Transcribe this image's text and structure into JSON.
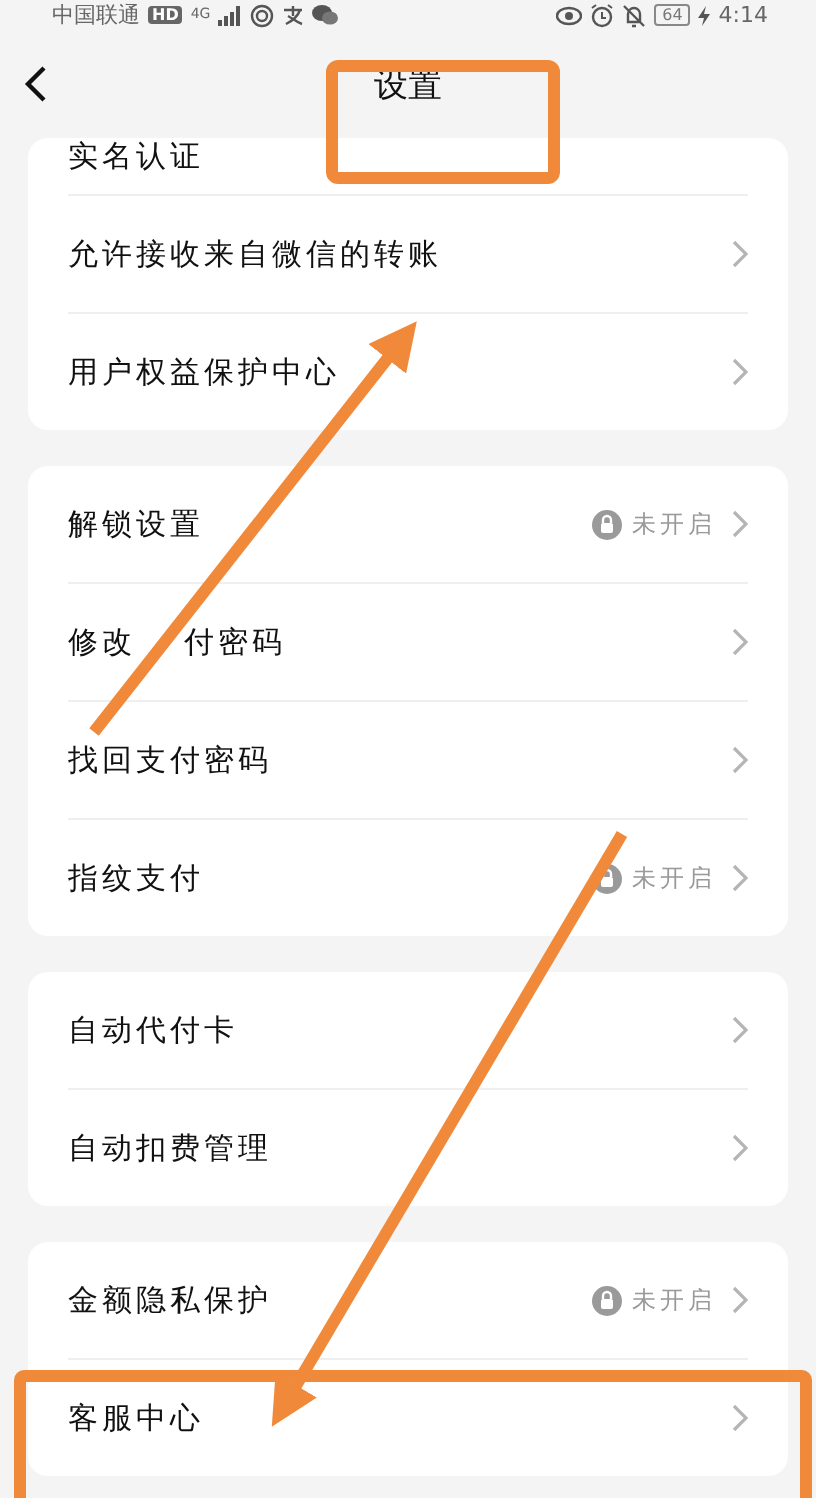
{
  "status_bar": {
    "carrier": "中国联通",
    "hd_badge": "HD",
    "network": "4G",
    "battery": "64",
    "time": "4:14"
  },
  "header": {
    "title": "设置"
  },
  "groups": [
    {
      "items": [
        {
          "label": "实名认证",
          "cut": true
        },
        {
          "label": "允许接收来自微信的转账"
        },
        {
          "label": "用户权益保护中心"
        }
      ]
    },
    {
      "items": [
        {
          "label": "解锁设置",
          "status": "未开启"
        },
        {
          "label_parts": [
            "修改",
            "付密码"
          ]
        },
        {
          "label": "找回支付密码"
        },
        {
          "label": "指纹支付",
          "status": "未开启"
        }
      ]
    },
    {
      "items": [
        {
          "label": "自动代付卡"
        },
        {
          "label": "自动扣费管理"
        }
      ]
    },
    {
      "items": [
        {
          "label": "金额隐私保护",
          "status": "未开启"
        },
        {
          "label": "客服中心"
        }
      ]
    }
  ]
}
